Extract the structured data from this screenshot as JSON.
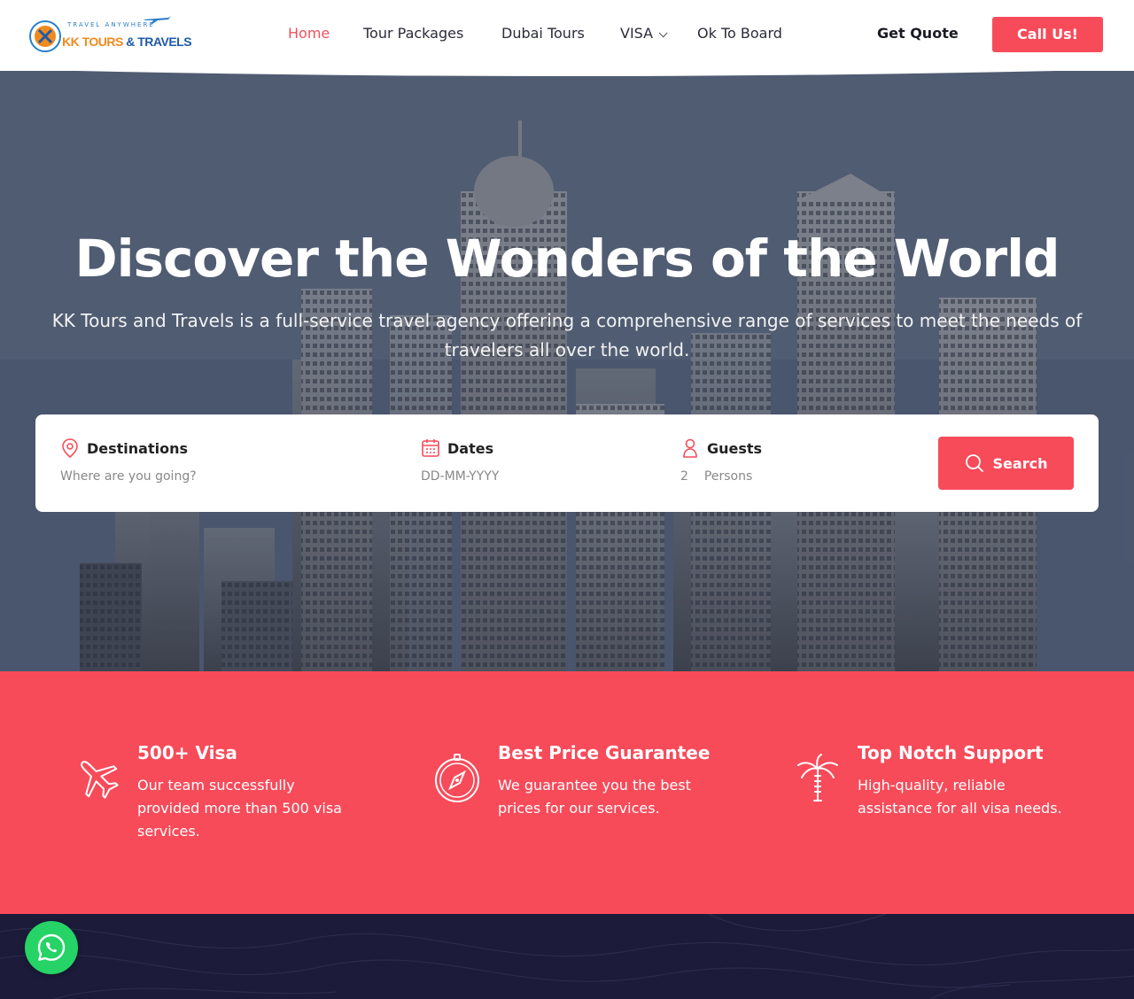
{
  "brand": {
    "tagline": "TRAVEL ANYWHERE",
    "name_part1": "KK TOURS",
    "name_part2": " & TRAVELS",
    "accent_color": "#f74b5a"
  },
  "nav": {
    "items": [
      "Home",
      "Tour Packages",
      "Dubai Tours",
      "VISA",
      "Ok To Board"
    ],
    "active": "Home",
    "get_quote": "Get Quote",
    "call_button": "Call Us!"
  },
  "hero": {
    "title": "Discover the Wonders of the World",
    "subtitle": "KK Tours and Travels is a full-service travel agency offering a comprehensive range of services to meet the needs of travelers all over the world."
  },
  "search": {
    "destinations_label": "Destinations",
    "destinations_placeholder": "Where are you going?",
    "dates_label": "Dates",
    "dates_placeholder": "DD-MM-YYYY",
    "guests_label": "Guests",
    "guests_count": "2",
    "guests_unit": "Persons",
    "button_label": "Search"
  },
  "features": [
    {
      "icon": "airplane-icon",
      "title": "500+ Visa",
      "text": "Our team successfully provided more than 500 visa services."
    },
    {
      "icon": "compass-icon",
      "title": "Best Price Guarantee",
      "text": "We guarantee you the best prices for our services."
    },
    {
      "icon": "palm-tree-icon",
      "title": "Top Notch Support",
      "text": "High-quality, reliable assistance for all visa needs."
    }
  ],
  "whatsapp": {
    "icon": "whatsapp-icon"
  }
}
